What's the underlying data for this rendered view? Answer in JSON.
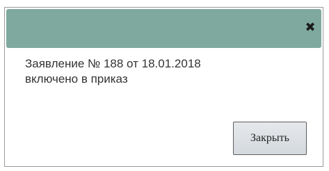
{
  "dialog": {
    "close_icon": "close-icon",
    "close_glyph": "✖",
    "message_line1": "Заявление № 188 от 18.01.2018",
    "message_line2": "включено в приказ",
    "close_button_label": "Закрыть"
  },
  "colors": {
    "titlebar": "#7fa99f",
    "button_border": "#5c5c5c"
  }
}
